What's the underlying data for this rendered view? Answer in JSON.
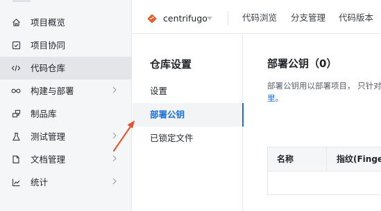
{
  "sidebar": {
    "items": [
      {
        "label": "项目概览",
        "icon": "home-icon",
        "has_chevron": false,
        "active": false
      },
      {
        "label": "项目协同",
        "icon": "checkbox-icon",
        "has_chevron": false,
        "active": false
      },
      {
        "label": "代码仓库",
        "icon": "code-icon",
        "has_chevron": false,
        "active": true
      },
      {
        "label": "构建与部署",
        "icon": "infinity-icon",
        "has_chevron": true,
        "active": false
      },
      {
        "label": "制品库",
        "icon": "package-icon",
        "has_chevron": false,
        "active": false
      },
      {
        "label": "测试管理",
        "icon": "flask-icon",
        "has_chevron": true,
        "active": false
      },
      {
        "label": "文档管理",
        "icon": "document-icon",
        "has_chevron": true,
        "active": false
      },
      {
        "label": "统计",
        "icon": "chart-icon",
        "has_chevron": true,
        "active": false
      }
    ]
  },
  "header": {
    "repo_name": "centrifugo",
    "tabs": [
      "代码浏览",
      "分支管理",
      "代码版本"
    ],
    "colors": {
      "repo_logo": "#e85d2c"
    }
  },
  "settings": {
    "title": "仓库设置",
    "items": [
      {
        "label": "设置",
        "active": false
      },
      {
        "label": "部署公钥",
        "active": true
      },
      {
        "label": "已锁定文件",
        "active": false
      }
    ]
  },
  "main": {
    "title": "部署公钥（0）",
    "description": "部署公钥用以部署项目， 只针对",
    "description_link": "里。",
    "table": {
      "columns": [
        "名称",
        "指纹(Fingerprint)"
      ]
    }
  },
  "colors": {
    "accent": "#1f6fd1",
    "annotation": "#e8502a",
    "sidebar_bg": "#f5f6f7"
  }
}
